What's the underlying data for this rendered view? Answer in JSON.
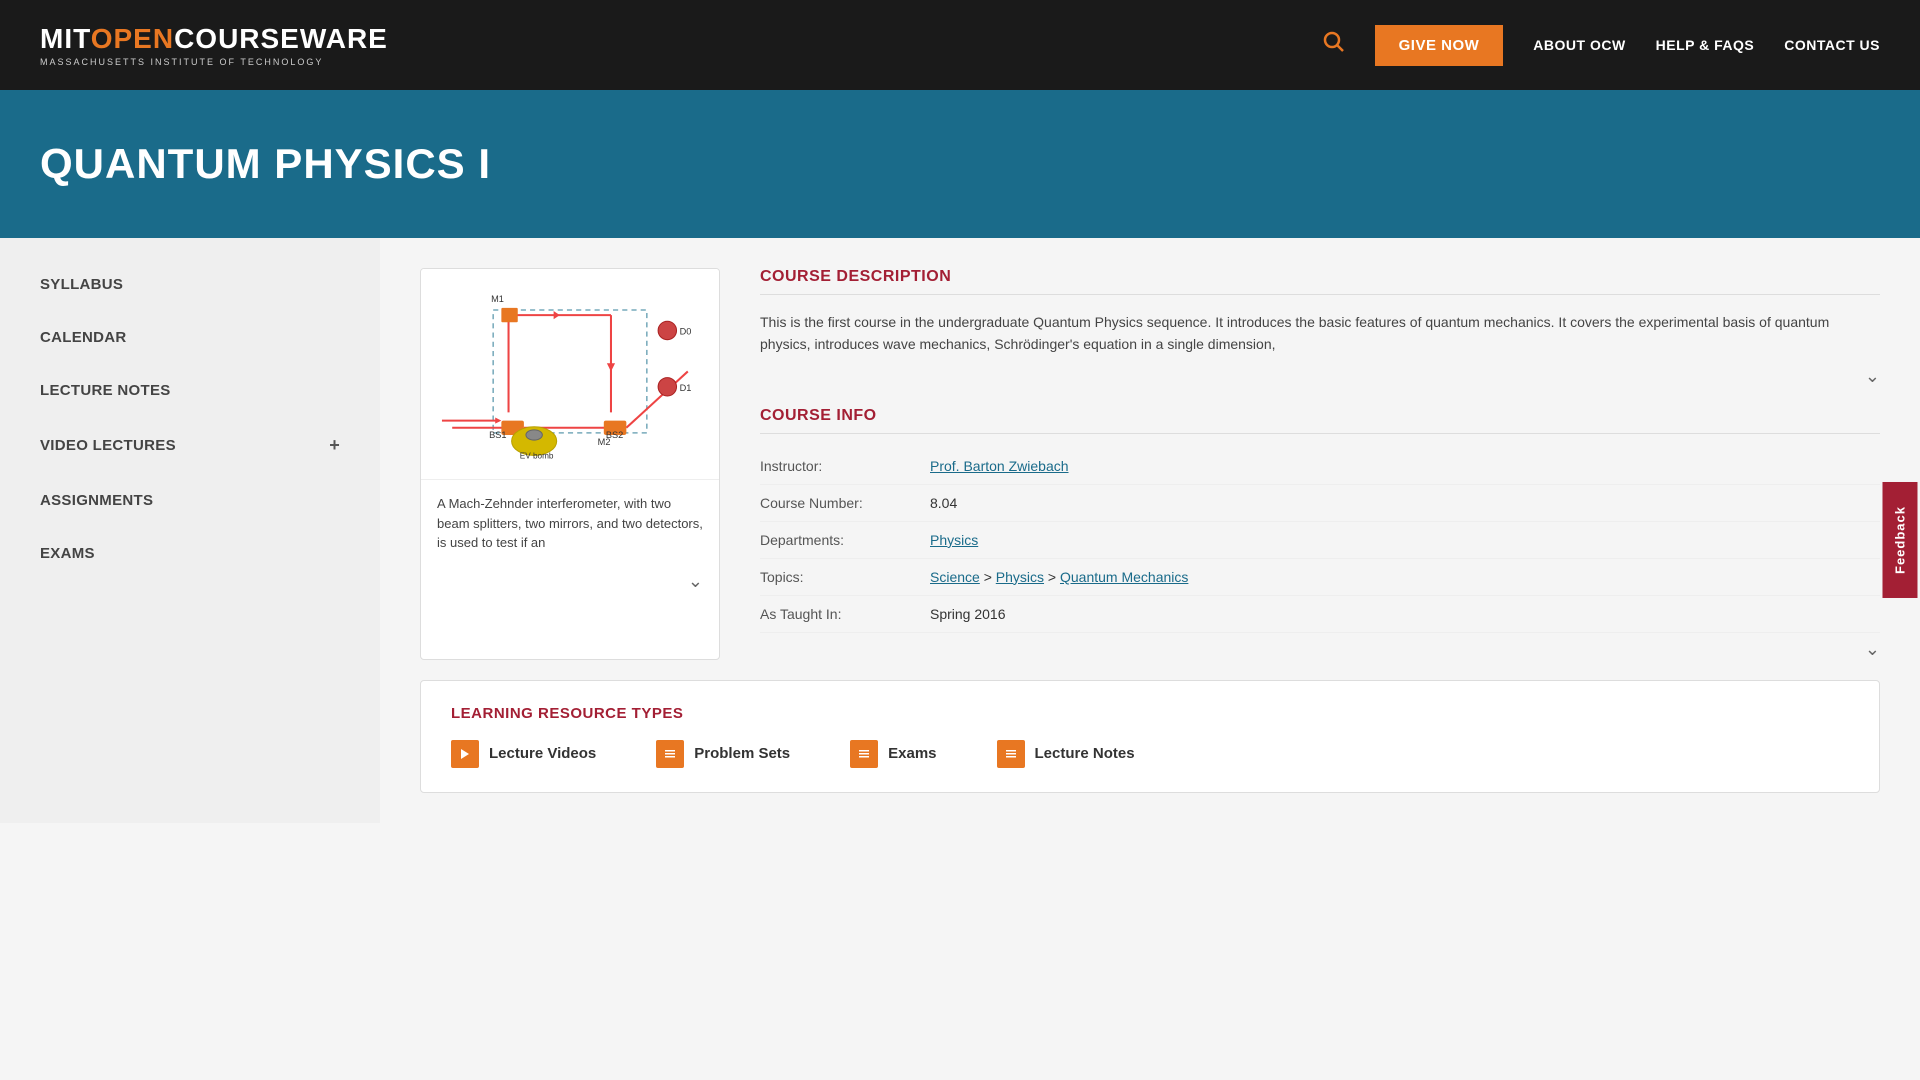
{
  "header": {
    "logo_mit": "MIT",
    "logo_open": "OPEN",
    "logo_courseware": "COURSEWARE",
    "logo_sub": "MASSACHUSETTS INSTITUTE OF TECHNOLOGY",
    "give_now_label": "GIVE NOW",
    "nav_items": [
      {
        "id": "about-ocw",
        "label": "ABOUT OCW"
      },
      {
        "id": "help-faqs",
        "label": "HELP & FAQS"
      },
      {
        "id": "contact-us",
        "label": "CONTACT US"
      }
    ]
  },
  "hero": {
    "title": "QUANTUM PHYSICS I"
  },
  "sidebar": {
    "items": [
      {
        "id": "syllabus",
        "label": "SYLLABUS",
        "has_expand": false
      },
      {
        "id": "calendar",
        "label": "CALENDAR",
        "has_expand": false
      },
      {
        "id": "lecture-notes",
        "label": "LECTURE NOTES",
        "has_expand": false
      },
      {
        "id": "video-lectures",
        "label": "VIDEO LECTURES",
        "has_expand": true
      },
      {
        "id": "assignments",
        "label": "ASSIGNMENTS",
        "has_expand": false
      },
      {
        "id": "exams",
        "label": "EXAMS",
        "has_expand": false
      }
    ]
  },
  "course_image": {
    "caption": "A Mach-Zehnder interferometer, with two beam splitters, two mirrors, and two detectors, is used to test if an"
  },
  "course_description": {
    "section_title": "COURSE DESCRIPTION",
    "text": "This is the first course in the undergraduate Quantum Physics sequence. It introduces the basic features of quantum mechanics. It covers the experimental basis of quantum physics, introduces wave mechanics, Schrödinger's equation in a single dimension,"
  },
  "course_info": {
    "section_title": "COURSE INFO",
    "rows": [
      {
        "label": "Instructor:",
        "value": "Prof. Barton Zwiebach",
        "is_link": true
      },
      {
        "label": "Course Number:",
        "value": "8.04",
        "is_link": false
      },
      {
        "label": "Departments:",
        "value": "Physics",
        "is_link": true
      },
      {
        "label": "Topics:",
        "value": "Science > Physics > Quantum Mechanics",
        "is_link": true,
        "parts": [
          "Science",
          "Physics",
          "Quantum Mechanics"
        ]
      },
      {
        "label": "As Taught In:",
        "value": "Spring 2016",
        "is_link": false
      }
    ]
  },
  "learning_resources": {
    "section_title": "LEARNING RESOURCE TYPES",
    "items": [
      {
        "id": "lecture-videos",
        "label": "Lecture Videos",
        "icon": "▶"
      },
      {
        "id": "problem-sets",
        "label": "Problem Sets",
        "icon": "≡"
      },
      {
        "id": "exams",
        "label": "Exams",
        "icon": "≡"
      },
      {
        "id": "lecture-notes",
        "label": "Lecture Notes",
        "icon": "≡"
      }
    ]
  },
  "feedback": {
    "label": "Feedback"
  }
}
